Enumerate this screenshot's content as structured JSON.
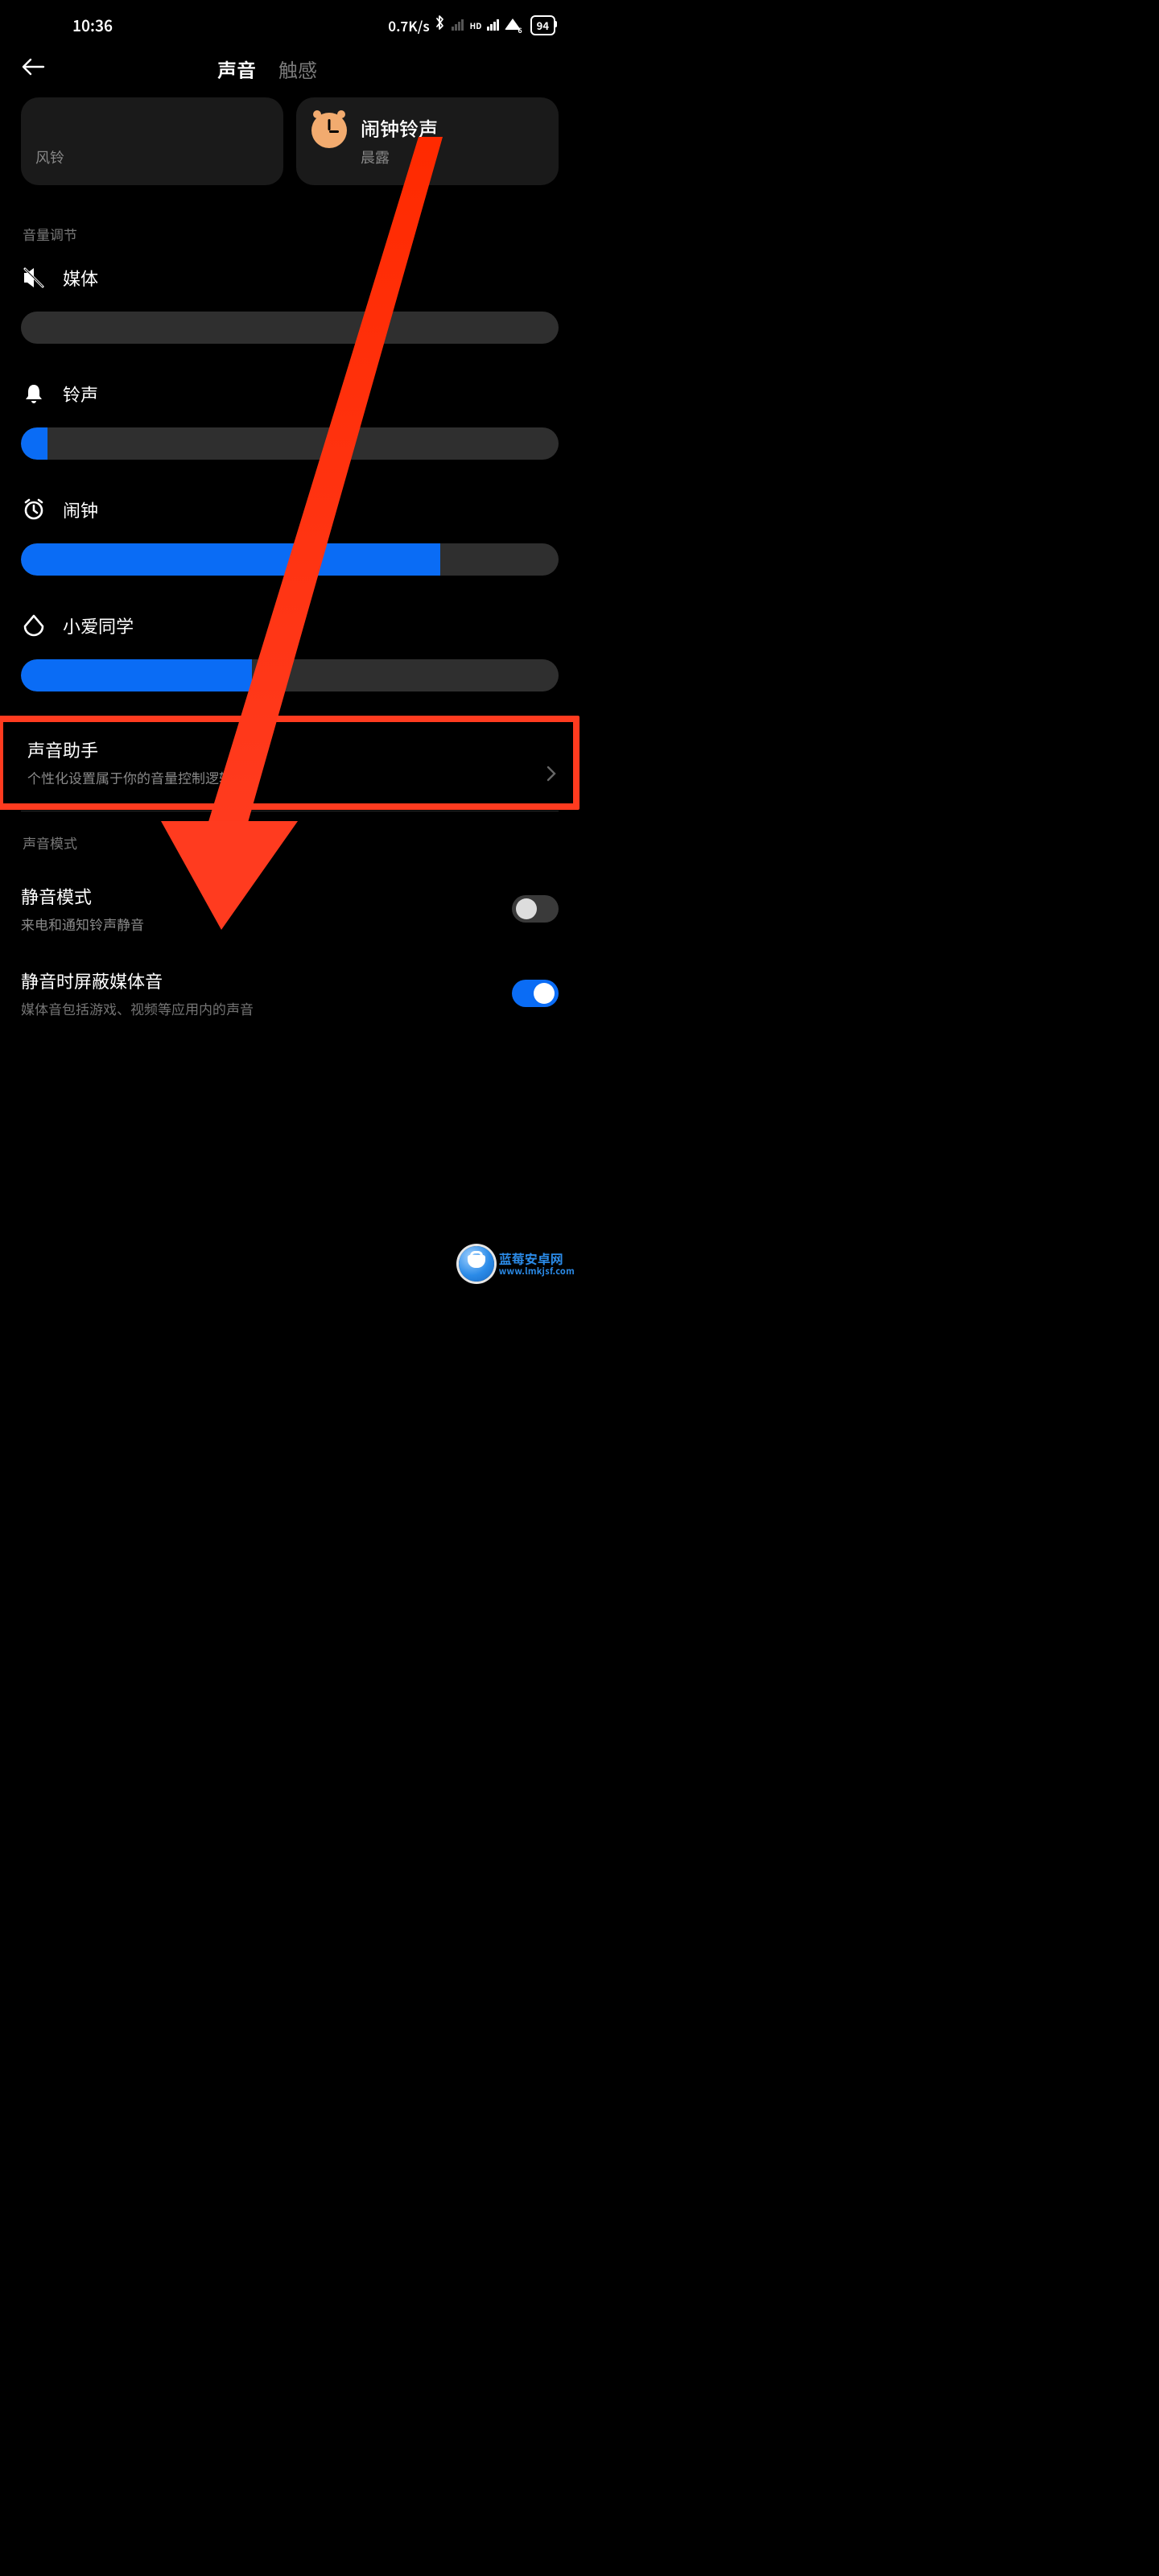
{
  "status": {
    "time": "10:36",
    "net_speed": "0.7K/s",
    "hd": "HD",
    "wifi_sub": "6",
    "battery": "94"
  },
  "header": {
    "tab_sound": "声音",
    "tab_haptics": "触感"
  },
  "cards": {
    "left_sub": "风铃",
    "alarm_title": "闹钟铃声",
    "alarm_sub": "晨露"
  },
  "sections": {
    "volume_header": "音量调节",
    "sound_mode_header": "声音模式"
  },
  "volumes": [
    {
      "name": "媒体",
      "value": 0,
      "icon": "media"
    },
    {
      "name": "铃声",
      "value": 5,
      "icon": "bell"
    },
    {
      "name": "闹钟",
      "value": 78,
      "icon": "alarm"
    },
    {
      "name": "小爱同学",
      "value": 43,
      "icon": "xiaoai"
    }
  ],
  "sound_assistant": {
    "title": "声音助手",
    "sub": "个性化设置属于你的音量控制逻辑"
  },
  "silent": {
    "title": "静音模式",
    "sub": "来电和通知铃声静音",
    "on": false
  },
  "silent_media": {
    "title": "静音时屏蔽媒体音",
    "sub": "媒体音包括游戏、视频等应用内的声音",
    "on": true
  },
  "watermark": {
    "name": "蓝莓安卓网",
    "url": "www.lmkjsf.com"
  }
}
